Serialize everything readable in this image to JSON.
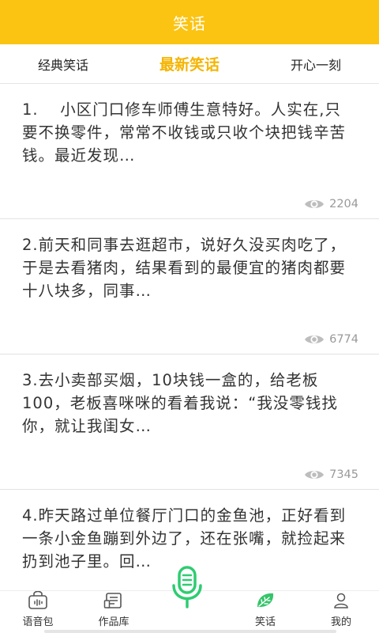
{
  "header": {
    "title": "笑话"
  },
  "tabs": [
    {
      "label": "经典笑话",
      "active": false
    },
    {
      "label": "最新笑话",
      "active": true
    },
    {
      "label": "开心一刻",
      "active": false
    }
  ],
  "jokes": [
    {
      "text": "1.　 小区门口修车师傅生意特好。人实在,只要不换零件，常常不收钱或只收个块把钱辛苦钱。最近发现…",
      "views": "2204"
    },
    {
      "text": "2.前天和同事去逛超市，说好久没买肉吃了，于是去看猪肉，结果看到的最便宜的猪肉都要十八块多，同事…",
      "views": "6774"
    },
    {
      "text": "3.去小卖部买烟，10块钱一盒的，给老板100，老板喜咪咪的看着我说：“我没零钱找你，就让我闺女…",
      "views": "7345"
    },
    {
      "text": "4.昨天路过单位餐厅门口的金鱼池，正好看到一条小金鱼蹦到外边了，还在张嘴，就捡起来扔到池子里。回…",
      "views": ""
    }
  ],
  "bottom_nav": [
    {
      "label": "语音包",
      "icon": "voice-pack-icon"
    },
    {
      "label": "作品库",
      "icon": "works-library-icon"
    },
    {
      "label": "",
      "icon": "microphone-icon"
    },
    {
      "label": "笑话",
      "icon": "jokes-leaf-icon"
    },
    {
      "label": "我的",
      "icon": "profile-icon"
    }
  ],
  "colors": {
    "brand": "#fbc412",
    "active_tab": "#f5b400",
    "mic": "#2ecc71"
  }
}
